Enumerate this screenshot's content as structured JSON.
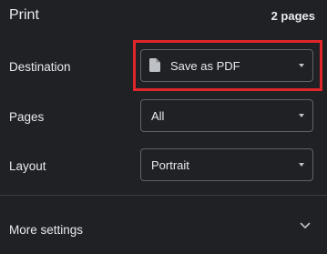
{
  "header": {
    "title": "Print",
    "page_count": "2 pages"
  },
  "settings": {
    "destination": {
      "label": "Destination",
      "value": "Save as PDF",
      "icon": "file-icon"
    },
    "pages": {
      "label": "Pages",
      "value": "All"
    },
    "layout": {
      "label": "Layout",
      "value": "Portrait"
    }
  },
  "more_settings": {
    "label": "More settings",
    "icon": "chevron-down-icon"
  },
  "colors": {
    "background": "#202124",
    "text": "#e8eaed",
    "border": "#5f6368",
    "highlight": "#e0252b"
  }
}
